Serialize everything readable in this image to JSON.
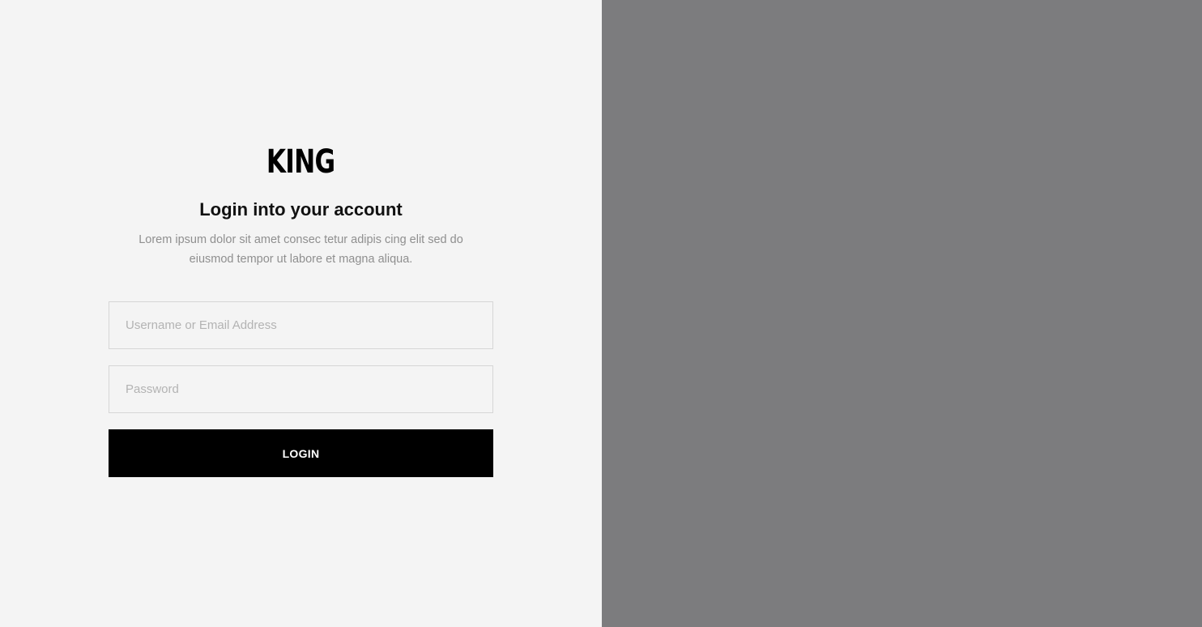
{
  "brand": {
    "logo_text": "KING"
  },
  "login": {
    "heading": "Login into your account",
    "description": "Lorem ipsum dolor sit amet consec tetur adipis cing elit sed do eiusmod tempor ut labore et magna aliqua.",
    "username": {
      "placeholder": "Username or Email Address",
      "value": ""
    },
    "password": {
      "placeholder": "Password",
      "value": ""
    },
    "submit_label": "LOGIN"
  },
  "colors": {
    "left_background": "#f4f4f4",
    "right_background": "#7c7c7e",
    "button_background": "#000000",
    "button_text": "#ffffff"
  }
}
